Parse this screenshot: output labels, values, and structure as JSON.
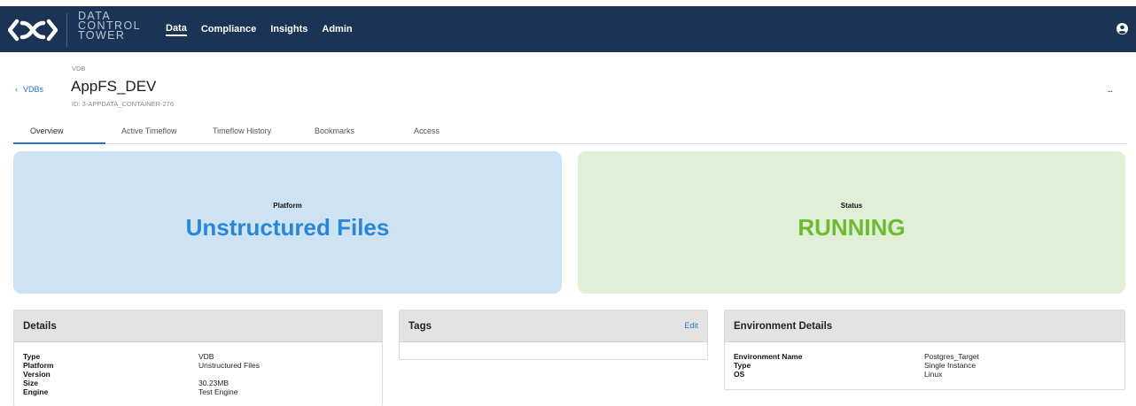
{
  "brand": {
    "lines": [
      "DATA",
      "CONTROL",
      "TOWER"
    ]
  },
  "nav": {
    "items": [
      "Data",
      "Compliance",
      "Insights",
      "Admin"
    ],
    "active": "Data"
  },
  "header": {
    "back_label": "VDBs",
    "type_label": "VDB",
    "title": "AppFS_DEV",
    "id_text": "ID: 3-APPDATA_CONTAINER-276",
    "more_label": "..."
  },
  "tabs": [
    "Overview",
    "Active Timeflow",
    "Timeflow History",
    "Bookmarks",
    "Access"
  ],
  "hero": {
    "platform": {
      "label": "Platform",
      "value": "Unstructured Files"
    },
    "status": {
      "label": "Status",
      "value": "RUNNING"
    }
  },
  "details": {
    "title": "Details",
    "rows": [
      {
        "key": "Type",
        "value": "VDB"
      },
      {
        "key": "Platform",
        "value": "Unstructured Files"
      },
      {
        "key": "Version",
        "value": ""
      },
      {
        "key": "Size",
        "value": "30.23MB"
      },
      {
        "key": "Engine",
        "value": "Test Engine"
      }
    ]
  },
  "tags": {
    "title": "Tags",
    "edit_label": "Edit"
  },
  "environment": {
    "title": "Environment Details",
    "rows": [
      {
        "key": "Environment Name",
        "value": "Postgres_Target"
      },
      {
        "key": "Type",
        "value": "Single Instance"
      },
      {
        "key": "OS",
        "value": "Linux"
      }
    ]
  },
  "colors": {
    "nav_bg": "#1b3456",
    "link": "#2a74c7",
    "platform_bg": "#cde3f3",
    "platform_text": "#2a86d8",
    "status_bg": "#e2efd7",
    "status_text": "#6cbb30"
  },
  "icons": [
    "logo-mark-icon",
    "user-account-icon",
    "chevron-left-icon"
  ]
}
